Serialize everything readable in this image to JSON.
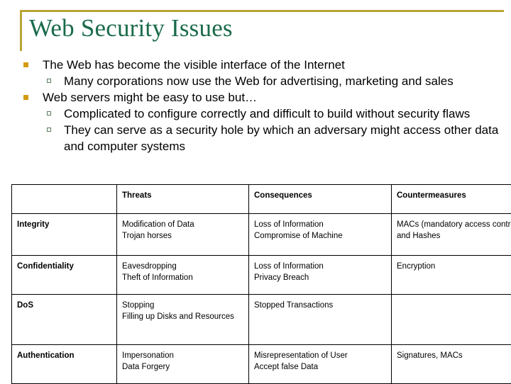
{
  "slide": {
    "title": "Web Security Issues",
    "accent_color": "#b8a536",
    "title_color": "#1a6b4a",
    "bullet1_color": "#d39b10",
    "bullet2_color": "#5d7a5d"
  },
  "bullets": [
    {
      "level": 1,
      "text": "The Web has become the visible interface of the Internet"
    },
    {
      "level": 2,
      "text": "Many corporations now use the Web for advertising, marketing and sales"
    },
    {
      "level": 1,
      "text": "Web servers might be easy to use but…"
    },
    {
      "level": 2,
      "text": "Complicated to configure correctly and difficult to build without security flaws"
    },
    {
      "level": 2,
      "text": "They can serve as a security hole by which an adversary might access other data and computer systems"
    }
  ],
  "table": {
    "headers": [
      "",
      "Threats",
      "Consequences",
      "Countermeasures"
    ],
    "rows": [
      {
        "category": "Integrity",
        "threats": [
          "Modification of Data",
          "Trojan horses"
        ],
        "consequences": [
          "Loss of Information",
          "Compromise of Machine"
        ],
        "countermeasures": [
          "MACs (mandatory access control) and Hashes"
        ]
      },
      {
        "category": "Confidentiality",
        "threats": [
          "Eavesdropping",
          "Theft of Information"
        ],
        "consequences": [
          "Loss of Information",
          "Privacy Breach"
        ],
        "countermeasures": [
          "Encryption"
        ]
      },
      {
        "category": "DoS",
        "threats": [
          "Stopping",
          "Filling up Disks and Resources"
        ],
        "consequences": [
          "Stopped Transactions"
        ],
        "countermeasures": [
          ""
        ]
      },
      {
        "category": "Authentication",
        "threats": [
          "Impersonation",
          "Data Forgery"
        ],
        "consequences": [
          "Misrepresentation of User",
          "Accept false Data"
        ],
        "countermeasures": [
          "Signatures, MACs"
        ]
      }
    ]
  }
}
